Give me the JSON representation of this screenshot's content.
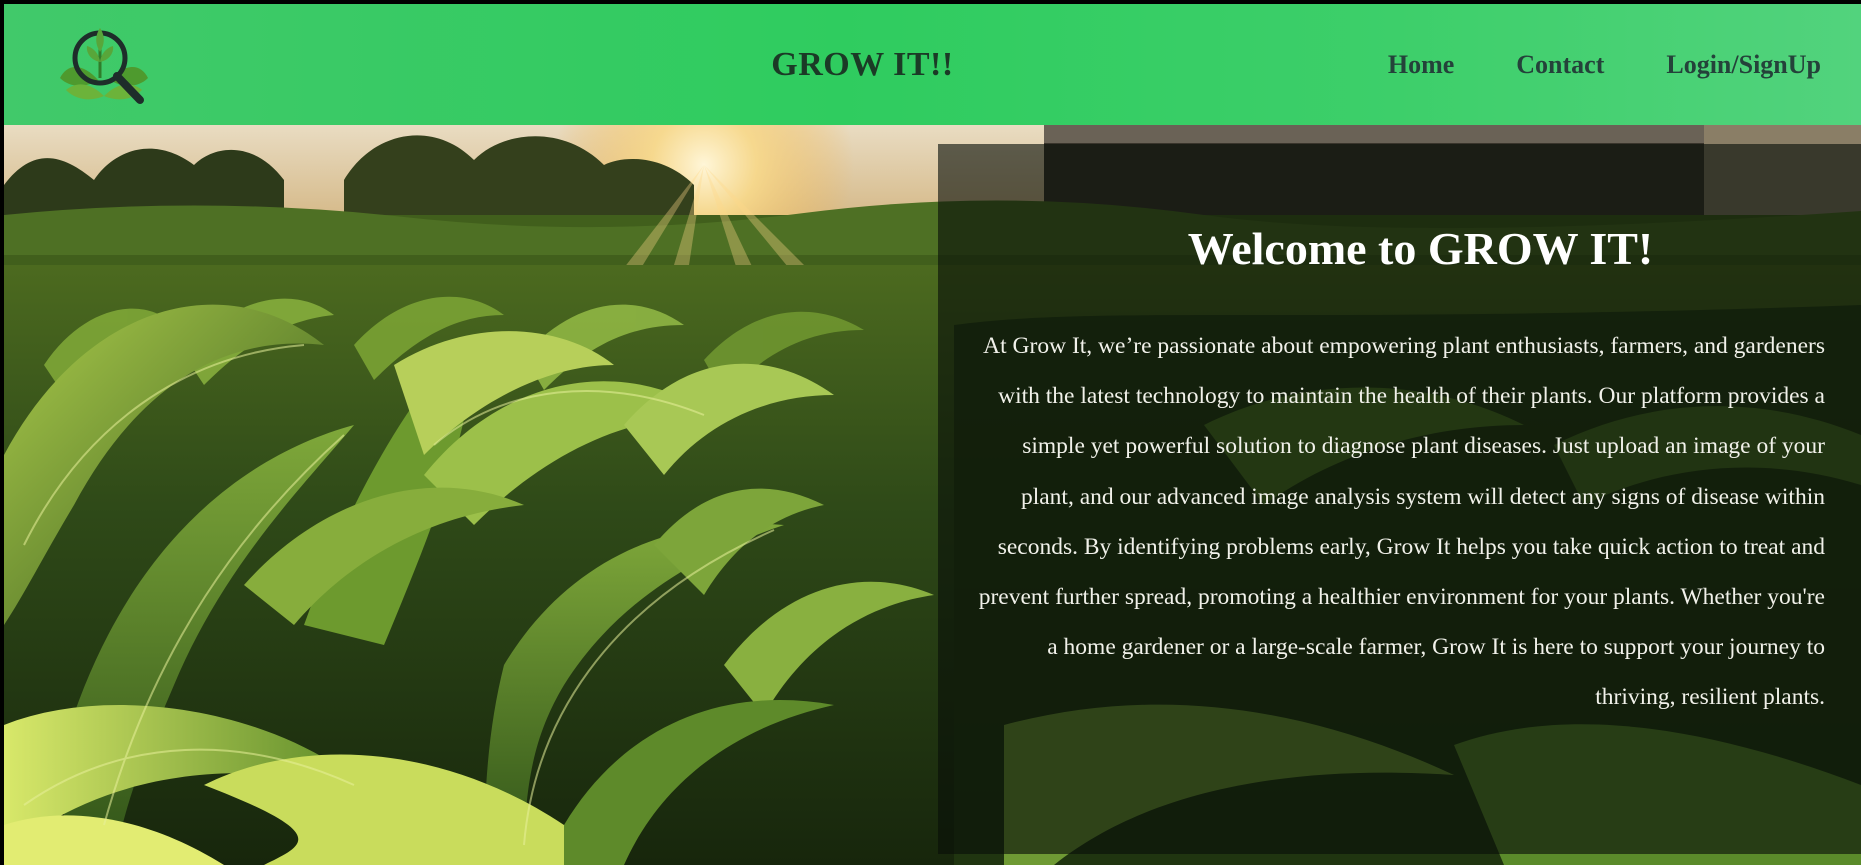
{
  "header": {
    "logo_icon": "leaf-magnifier-logo",
    "title": "GROW IT!!",
    "nav": [
      {
        "label": "Home"
      },
      {
        "label": "Contact"
      },
      {
        "label": "Login/SignUp"
      }
    ]
  },
  "hero": {
    "background": "cornfield-sunset-photo"
  },
  "welcome": {
    "title": "Welcome to GROW IT!",
    "body": "At Grow It, we’re passionate about empowering plant enthusiasts, farmers, and gardeners with the latest technology to maintain the health of their plants. Our platform provides a simple yet powerful solution to diagnose plant diseases. Just upload an image of your plant, and our advanced image analysis system will detect any signs of disease within seconds. By identifying problems early, Grow It helps you take quick action to treat and prevent further spread, promoting a healthier environment for your plants. Whether you're a home gardener or a large-scale farmer, Grow It is here to support your journey to thriving, resilient plants."
  },
  "colors": {
    "navbar": "#2fcc5f",
    "title_text": "#1b3a26",
    "nav_text": "#24423a",
    "panel_overlay": "#080e08"
  }
}
